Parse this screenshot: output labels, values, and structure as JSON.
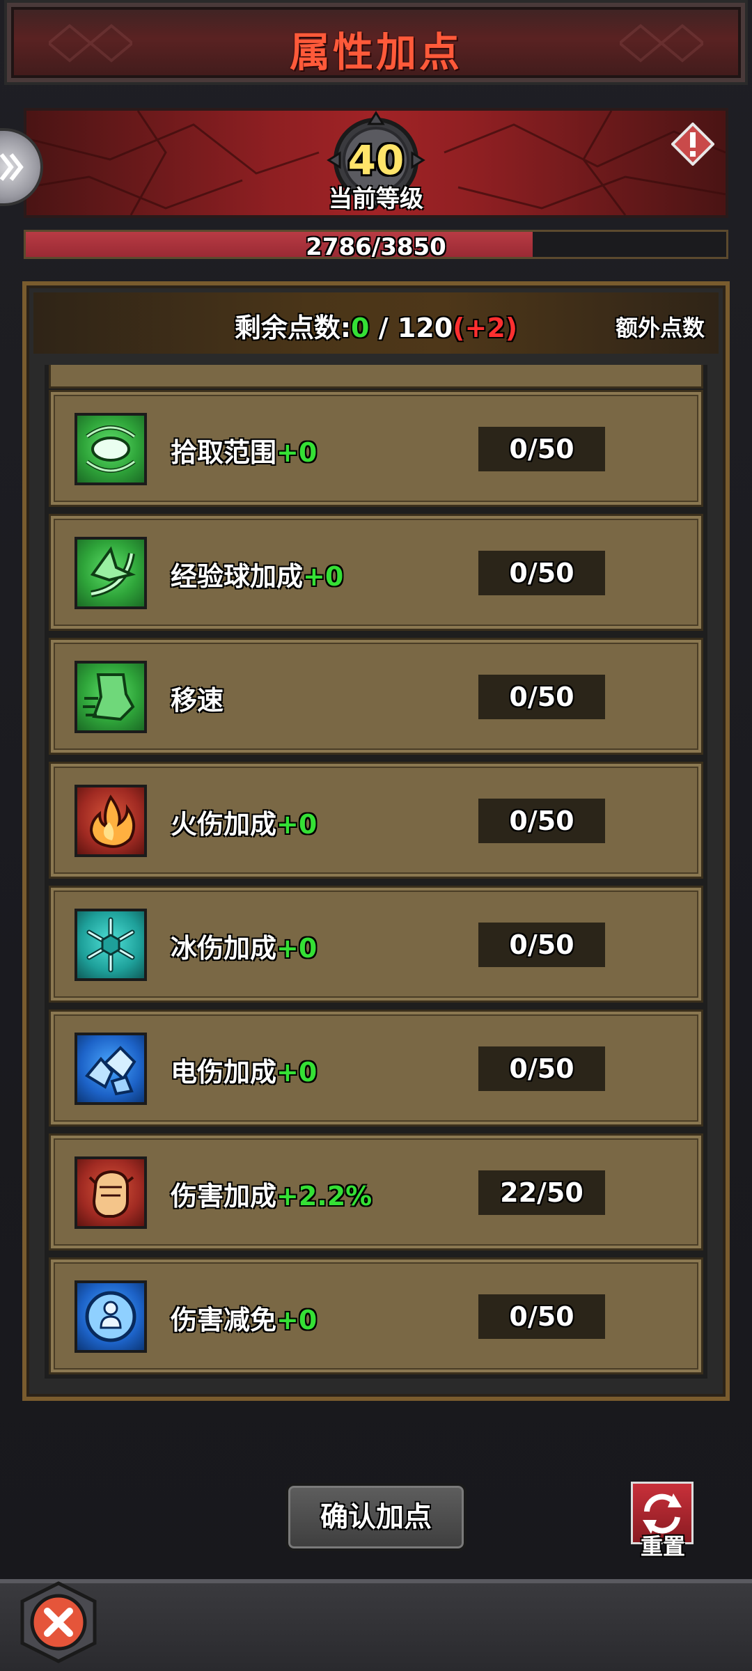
{
  "title": "属性加点",
  "level": {
    "value": "40",
    "label": "当前等级"
  },
  "xp": {
    "text": "2786/3850",
    "progress": 0.7237
  },
  "points": {
    "label": "剩余点数:",
    "remaining": "0",
    "separator": " / ",
    "total": "120",
    "extra": "(+2)",
    "extra_button": "额外点数"
  },
  "attributes": [
    {
      "name": "拾取范围",
      "bonus": "+0",
      "count": "0/50",
      "icon": "magnet-pickup-icon",
      "color": "green"
    },
    {
      "name": "经验球加成",
      "bonus": "+0",
      "count": "0/50",
      "icon": "exp-arrow-icon",
      "color": "green"
    },
    {
      "name": "移速",
      "bonus": "",
      "count": "0/50",
      "icon": "boot-speed-icon",
      "color": "green"
    },
    {
      "name": "火伤加成",
      "bonus": "+0",
      "count": "0/50",
      "icon": "fire-icon",
      "color": "red"
    },
    {
      "name": "冰伤加成",
      "bonus": "+0",
      "count": "0/50",
      "icon": "snowflake-icon",
      "color": "teal"
    },
    {
      "name": "电伤加成",
      "bonus": "+0",
      "count": "0/50",
      "icon": "lightning-crystal-icon",
      "color": "blue"
    },
    {
      "name": "伤害加成",
      "bonus": "+2.2%",
      "count": "22/50",
      "icon": "fist-icon",
      "color": "red"
    },
    {
      "name": "伤害减免",
      "bonus": "+0",
      "count": "0/50",
      "icon": "shield-person-icon",
      "color": "blue"
    }
  ],
  "buttons": {
    "confirm": "确认加点",
    "reset": "重置"
  },
  "colors": {
    "accent_red": "#ff5a3a",
    "bonus_green": "#35e035",
    "extra_red": "#ff3030",
    "xp_fill": "#b83b44",
    "row_bg": "#7a6845"
  }
}
